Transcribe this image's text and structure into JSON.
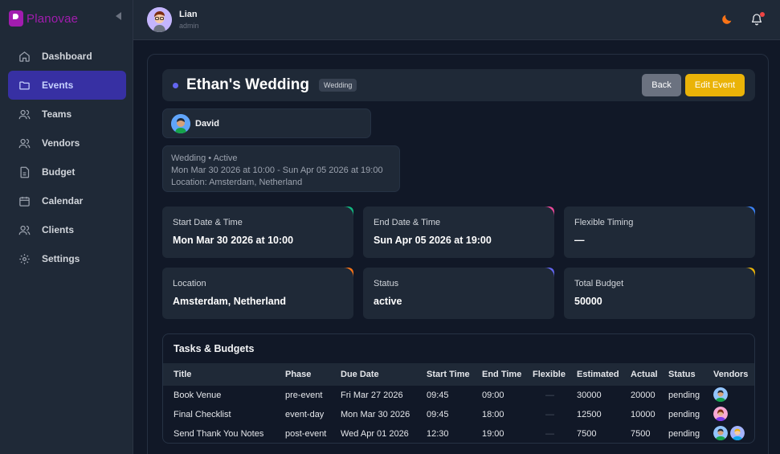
{
  "brand": {
    "name": "Planovae",
    "accent": "#a21caf"
  },
  "nav": {
    "items": [
      {
        "label": "Dashboard",
        "icon": "home-icon"
      },
      {
        "label": "Events",
        "icon": "folder-icon",
        "active": true
      },
      {
        "label": "Teams",
        "icon": "users-icon"
      },
      {
        "label": "Vendors",
        "icon": "users-icon"
      },
      {
        "label": "Budget",
        "icon": "document-icon"
      },
      {
        "label": "Calendar",
        "icon": "calendar-icon"
      },
      {
        "label": "Clients",
        "icon": "users-icon"
      },
      {
        "label": "Settings",
        "icon": "gear-icon"
      }
    ]
  },
  "user": {
    "name": "Lian",
    "role": "admin"
  },
  "event": {
    "title": "Ethan's Wedding",
    "badge": "Wedding",
    "back_label": "Back",
    "edit_label": "Edit Event",
    "client": "David",
    "summary": {
      "line1": "Wedding • Active",
      "line2": "Mon Mar 30 2026 at 10:00 - Sun Apr 05 2026 at 19:00",
      "line3": "Location: Amsterdam, Netherland"
    }
  },
  "cards": [
    {
      "label": "Start Date & Time",
      "value": "Mon Mar 30 2026 at 10:00",
      "color": "#10b981"
    },
    {
      "label": "End Date & Time",
      "value": "Sun Apr 05 2026 at 19:00",
      "color": "#ec4899"
    },
    {
      "label": "Flexible Timing",
      "value": "—",
      "color": "#3b82f6"
    },
    {
      "label": "Location",
      "value": "Amsterdam, Netherland",
      "color": "#f97316"
    },
    {
      "label": "Status",
      "value": "active",
      "color": "#6366f1"
    },
    {
      "label": "Total Budget",
      "value": "50000",
      "color": "#eab308"
    }
  ],
  "tasks": {
    "title": "Tasks & Budgets",
    "columns": [
      "Title",
      "Phase",
      "Due Date",
      "Start Time",
      "End Time",
      "Flexible",
      "Estimated",
      "Actual",
      "Status",
      "Vendors"
    ],
    "rows": [
      {
        "title": "Book Venue",
        "phase": "pre-event",
        "due": "Fri Mar 27 2026",
        "start": "09:45",
        "end": "09:00",
        "flexible": "—",
        "estimated": "30000",
        "actual": "20000",
        "status": "pending",
        "vendors": 1
      },
      {
        "title": "Final Checklist",
        "phase": "event-day",
        "due": "Mon Mar 30 2026",
        "start": "09:45",
        "end": "18:00",
        "flexible": "—",
        "estimated": "12500",
        "actual": "10000",
        "status": "pending",
        "vendors": 1
      },
      {
        "title": "Send Thank You Notes",
        "phase": "post-event",
        "due": "Wed Apr 01 2026",
        "start": "12:30",
        "end": "19:00",
        "flexible": "—",
        "estimated": "7500",
        "actual": "7500",
        "status": "pending",
        "vendors": 2
      }
    ]
  }
}
